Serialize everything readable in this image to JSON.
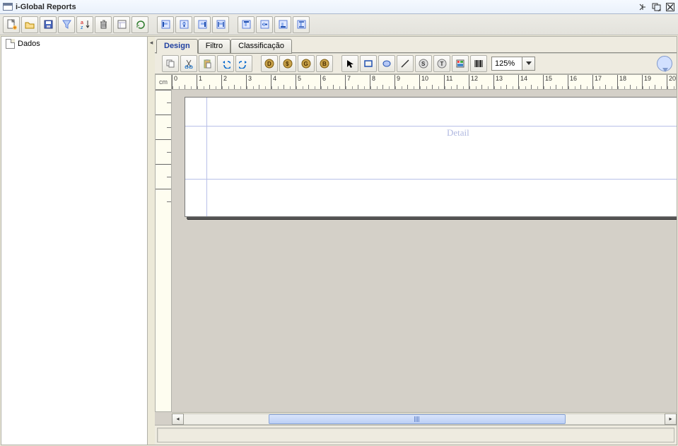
{
  "window": {
    "title": "i-Global Reports"
  },
  "sidebar": {
    "items": [
      {
        "label": "Dados"
      }
    ]
  },
  "tabs": [
    {
      "label": "Design",
      "active": true
    },
    {
      "label": "Filtro",
      "active": false
    },
    {
      "label": "Classificação",
      "active": false
    }
  ],
  "design_toolbar": {
    "zoom": "125%",
    "ruler_unit": "cm",
    "detail_label": "Detail"
  },
  "ruler": {
    "h_marks": [
      "0",
      "1",
      "2",
      "3",
      "4",
      "5",
      "6",
      "7",
      "8",
      "9",
      "10",
      "11",
      "12",
      "13",
      "14",
      "15",
      "16",
      "17",
      "18",
      "19",
      "20"
    ]
  },
  "icons": {
    "main_toolbar": [
      "new-report",
      "open",
      "save",
      "filter",
      "sort",
      "delete",
      "properties",
      "refresh",
      "align-left",
      "align-center",
      "align-right",
      "align-justify",
      "send-back",
      "bring-front",
      "move-left",
      "move-right"
    ],
    "design_toolbar_left": [
      "copy",
      "cut",
      "paste",
      "undo",
      "redo"
    ],
    "design_toolbar_mid": [
      "field-date",
      "field-currency",
      "field-general",
      "field-boolean"
    ],
    "design_toolbar_shapes": [
      "pointer",
      "rectangle",
      "ellipse",
      "line",
      "string",
      "text",
      "image",
      "barcode"
    ]
  },
  "colors": {
    "accent": "#5a7ed8",
    "ruler": "#fefdf0",
    "canvas": "#d4d0c8"
  }
}
